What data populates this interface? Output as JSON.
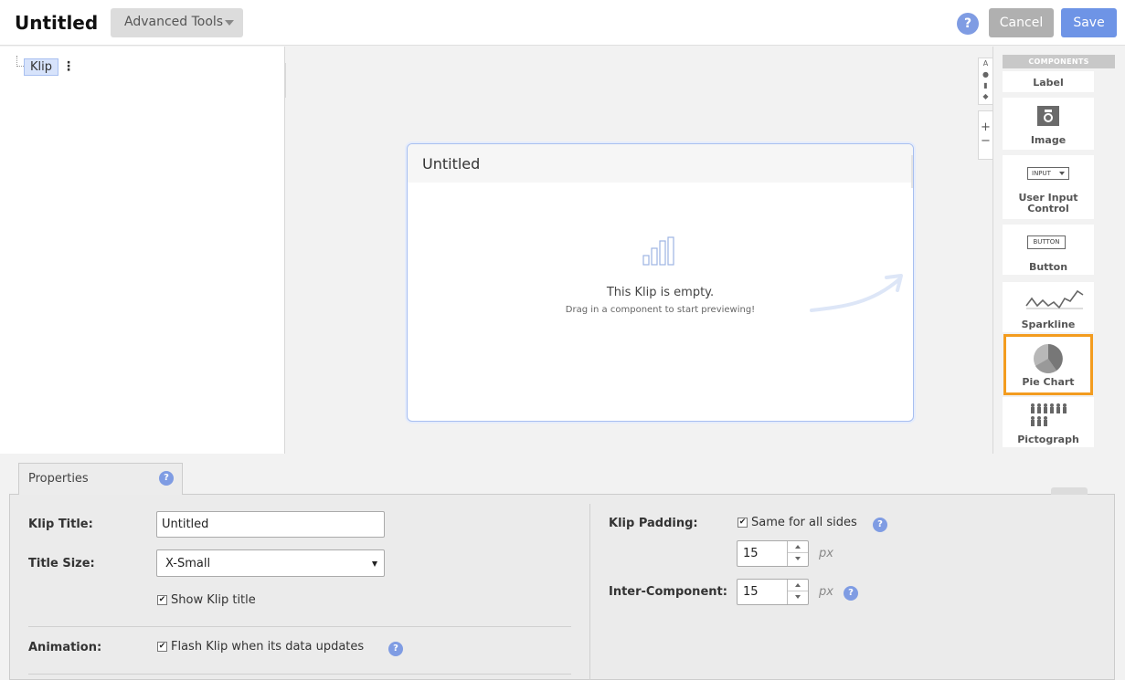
{
  "header": {
    "title": "Untitled",
    "advanced_tools": "Advanced Tools",
    "help": "?",
    "cancel": "Cancel",
    "save": "Save"
  },
  "tree": {
    "node_label": "Klip",
    "menu_glyph": "⋮"
  },
  "klip": {
    "title": "Untitled",
    "empty_title": "This Klip is empty.",
    "empty_subtitle": "Drag in a component to start previewing!"
  },
  "mini_tools": {
    "zoom_in": "+",
    "zoom_out": "−"
  },
  "components": {
    "header": "COMPONENTS",
    "items": [
      {
        "label": "Label",
        "icon": "label-icon"
      },
      {
        "label": "Image",
        "icon": "camera-icon"
      },
      {
        "label": "User Input Control",
        "icon": "input-dropdown-icon",
        "icon_text": "INPUT"
      },
      {
        "label": "Button",
        "icon": "button-icon",
        "icon_text": "BUTTON"
      },
      {
        "label": "Sparkline",
        "icon": "sparkline-icon"
      },
      {
        "label": "Pie Chart",
        "icon": "pie-chart-icon",
        "selected": true
      },
      {
        "label": "Pictograph",
        "icon": "pictograph-icon"
      }
    ],
    "highlight_color": "#f39c1f"
  },
  "properties": {
    "tab_label": "Properties",
    "help": "?",
    "klip_title_label": "Klip Title:",
    "klip_title_value": "Untitled",
    "title_size_label": "Title Size:",
    "title_size_value": "X-Small",
    "show_title_label": "Show Klip title",
    "show_title_checked": true,
    "animation_label": "Animation:",
    "flash_label": "Flash Klip when its data updates",
    "flash_checked": true,
    "padding_label": "Klip Padding:",
    "same_sides_label": "Same for all sides",
    "same_sides_checked": true,
    "padding_value": "15",
    "padding_unit": "px",
    "inter_label": "Inter-Component:",
    "inter_value": "15",
    "inter_unit": "px"
  },
  "colors": {
    "save": "#6e94e6",
    "cancel": "#b0b0b0",
    "help": "#7f9ce3"
  }
}
